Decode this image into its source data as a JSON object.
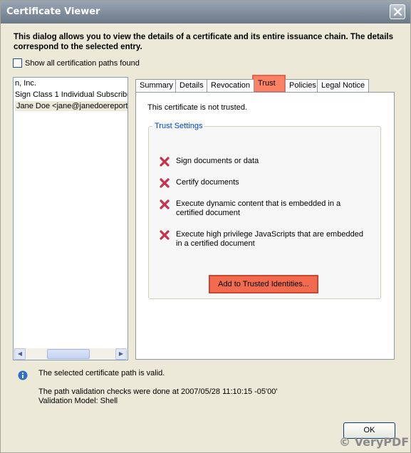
{
  "window": {
    "title": "Certificate Viewer"
  },
  "intro": {
    "text": "This dialog allows you to view the details of a certificate and its entire issuance chain. The details correspond to the selected entry."
  },
  "show_all_paths": {
    "label": "Show all certification paths found",
    "checked": false
  },
  "tree": {
    "items": [
      "n, Inc.",
      "Sign Class 1 Individual Subscribe",
      "Jane Doe <jane@janedoereport"
    ],
    "selected_index": 2
  },
  "tabs": [
    "Summary",
    "Details",
    "Revocation",
    "Trust",
    "Policies",
    "Legal Notice"
  ],
  "active_tab": "Trust",
  "trust_panel": {
    "status": "This certificate is not trusted.",
    "group_title": "Trust Settings",
    "items": [
      "Sign documents or data",
      "Certify documents",
      "Execute dynamic content that is embedded in a certified document",
      "Execute high privilege JavaScripts that are embedded in a certified document"
    ],
    "add_button": "Add to Trusted Identities..."
  },
  "status": {
    "valid": "The selected certificate path is valid.",
    "checks": "The path validation checks were done at 2007/05/28 11:10:15 -05'00'",
    "model": "Validation Model: Shell"
  },
  "ok_button": "OK",
  "watermark": "© VeryPDF",
  "colors": {
    "highlight": "#f26b4f",
    "deny_icon": "#c9304a",
    "group_title": "#0046d5"
  }
}
